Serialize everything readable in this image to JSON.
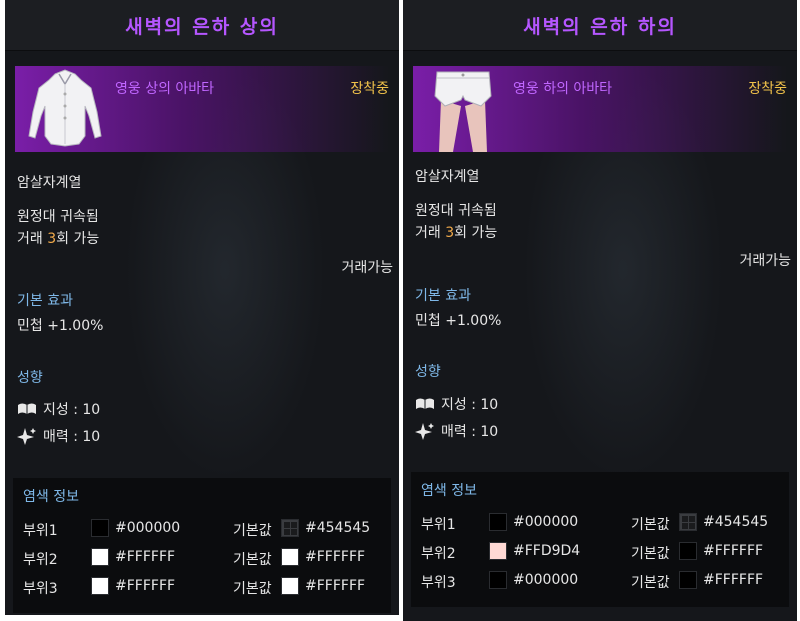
{
  "panels": [
    {
      "title": "새벽의 은하 상의",
      "avatar_name": "영웅 상의 아바타",
      "equipped": "장착중",
      "class": "암살자계열",
      "bound": "원정대 귀속됨",
      "trade_prefix": "거래 ",
      "trade_count": "3",
      "trade_suffix": "회 가능",
      "tradable": "거래가능",
      "base_effect_title": "기본 효과",
      "base_effect": "민첩 +1.00%",
      "tendency_title": "성향",
      "tendency_1": "지성 : 10",
      "tendency_2": "매력 : 10",
      "dye_title": "염색 정보",
      "dye_rows": [
        {
          "part": "부위1",
          "color": "#000000",
          "hex": "#000000",
          "default_label": "기본값",
          "default_color": "#454545",
          "default_hex": "#454545",
          "default_pattern": true
        },
        {
          "part": "부위2",
          "color": "#FFFFFF",
          "hex": "#FFFFFF",
          "default_label": "기본값",
          "default_color": "#FFFFFF",
          "default_hex": "#FFFFFF",
          "default_pattern": false
        },
        {
          "part": "부위3",
          "color": "#FFFFFF",
          "hex": "#FFFFFF",
          "default_label": "기본값",
          "default_color": "#FFFFFF",
          "default_hex": "#FFFFFF",
          "default_pattern": false
        }
      ]
    },
    {
      "title": "새벽의 은하 하의",
      "avatar_name": "영웅 하의 아바타",
      "equipped": "장착중",
      "class": "암살자계열",
      "bound": "원정대 귀속됨",
      "trade_prefix": "거래 ",
      "trade_count": "3",
      "trade_suffix": "회 가능",
      "tradable": "거래가능",
      "base_effect_title": "기본 효과",
      "base_effect": "민첩 +1.00%",
      "tendency_title": "성향",
      "tendency_1": "지성 : 10",
      "tendency_2": "매력 : 10",
      "dye_title": "염색 정보",
      "dye_rows": [
        {
          "part": "부위1",
          "color": "#000000",
          "hex": "#000000",
          "default_label": "기본값",
          "default_color": "#454545",
          "default_hex": "#454545",
          "default_pattern": true
        },
        {
          "part": "부위2",
          "color": "#FFD9D4",
          "hex": "#FFD9D4",
          "default_label": "기본값",
          "default_color": "#FFFFFF",
          "default_hex": "#FFFFFF",
          "default_pattern": false
        },
        {
          "part": "부위3",
          "color": "#000000",
          "hex": "#000000",
          "default_label": "기본값",
          "default_color": "#FFFFFF",
          "default_hex": "#FFFFFF",
          "default_pattern": false
        }
      ]
    }
  ],
  "colors": {
    "title": "#b556ff",
    "avatar_name": "#c066ff",
    "equipped": "#f0c24a",
    "section": "#7fb8e8",
    "highlight": "#f0a94a"
  },
  "icons": {
    "tendency_1": "open-book-icon",
    "tendency_2": "sparkle-icon",
    "item_left": "white-blouse-icon",
    "item_right": "white-shorts-icon"
  }
}
